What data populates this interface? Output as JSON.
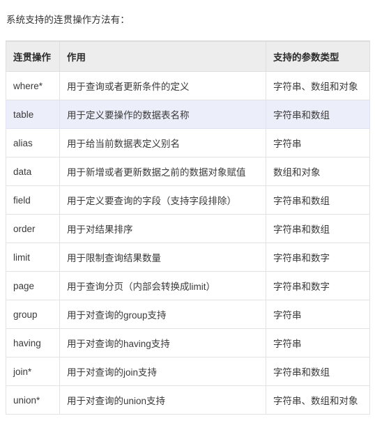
{
  "intro": "系统支持的连贯操作方法有：",
  "table": {
    "headers": [
      "连贯操作",
      "作用",
      "支持的参数类型"
    ],
    "rows": [
      {
        "op": "where*",
        "desc": "用于查询或者更新条件的定义",
        "types": "字符串、数组和对象",
        "highlight": false
      },
      {
        "op": "table",
        "desc": "用于定义要操作的数据表名称",
        "types": "字符串和数组",
        "highlight": true
      },
      {
        "op": "alias",
        "desc": "用于给当前数据表定义别名",
        "types": "字符串",
        "highlight": false
      },
      {
        "op": "data",
        "desc": "用于新增或者更新数据之前的数据对象赋值",
        "types": "数组和对象",
        "highlight": false
      },
      {
        "op": "field",
        "desc": "用于定义要查询的字段（支持字段排除）",
        "types": "字符串和数组",
        "highlight": false
      },
      {
        "op": "order",
        "desc": "用于对结果排序",
        "types": "字符串和数组",
        "highlight": false
      },
      {
        "op": "limit",
        "desc": "用于限制查询结果数量",
        "types": "字符串和数字",
        "highlight": false
      },
      {
        "op": "page",
        "desc": "用于查询分页（内部会转换成limit）",
        "types": "字符串和数字",
        "highlight": false
      },
      {
        "op": "group",
        "desc": "用于对查询的group支持",
        "types": "字符串",
        "highlight": false
      },
      {
        "op": "having",
        "desc": "用于对查询的having支持",
        "types": "字符串",
        "highlight": false
      },
      {
        "op": "join*",
        "desc": "用于对查询的join支持",
        "types": "字符串和数组",
        "highlight": false
      },
      {
        "op": "union*",
        "desc": "用于对查询的union支持",
        "types": "字符串、数组和对象",
        "highlight": false
      }
    ]
  },
  "colors": {
    "header_background": "#ededed",
    "highlight_row": "#eceefa",
    "border": "#e2e2e2",
    "text": "#333333",
    "page_background": "#ffffff"
  }
}
